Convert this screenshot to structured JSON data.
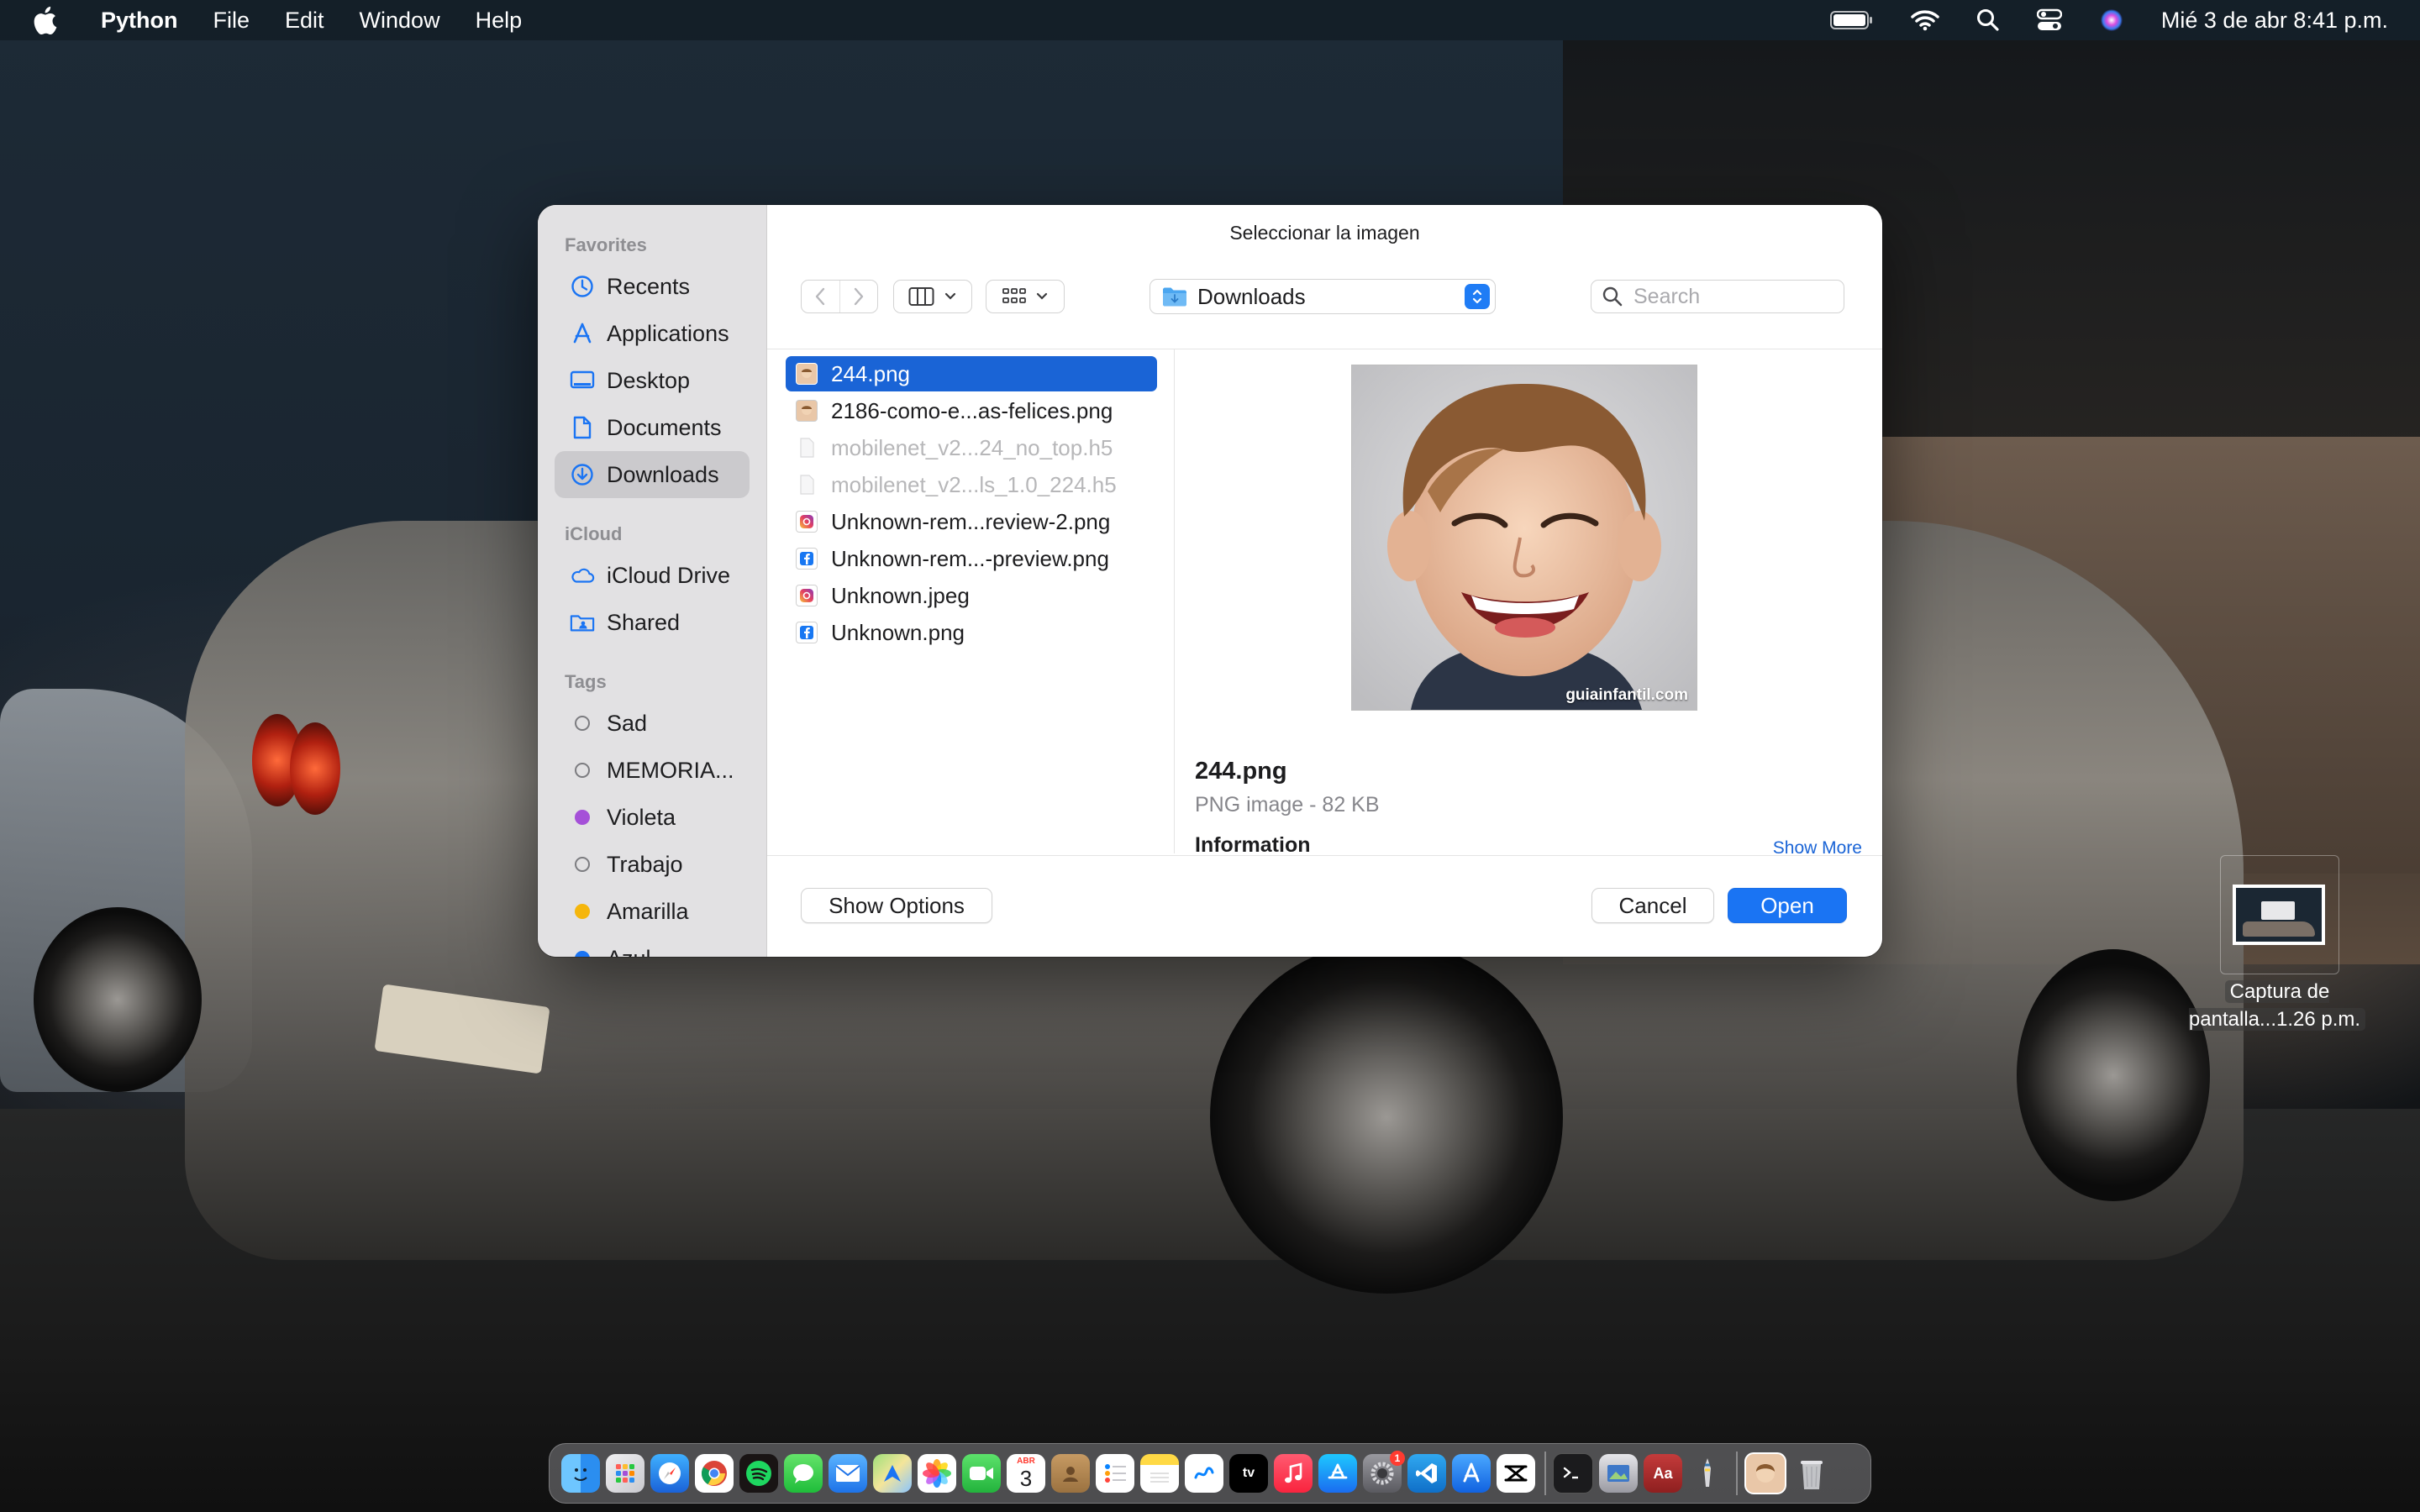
{
  "menubar": {
    "app_name": "Python",
    "menus": [
      "File",
      "Edit",
      "Window",
      "Help"
    ],
    "clock": "Mié 3 de abr  8:41 p.m."
  },
  "dialog": {
    "title": "Seleccionar la imagen",
    "location": "Downloads",
    "search_placeholder": "Search",
    "sidebar": {
      "favorites_header": "Favorites",
      "favorites": [
        "Recents",
        "Applications",
        "Desktop",
        "Documents",
        "Downloads"
      ],
      "icloud_header": "iCloud",
      "icloud": [
        "iCloud Drive",
        "Shared"
      ],
      "tags_header": "Tags",
      "tags": [
        {
          "label": "Sad",
          "color": "none"
        },
        {
          "label": "MEMORIA...",
          "color": "none"
        },
        {
          "label": "Violeta",
          "color": "#a550d8"
        },
        {
          "label": "Trabajo",
          "color": "none"
        },
        {
          "label": "Amarilla",
          "color": "#f5b60c"
        },
        {
          "label": "Azul",
          "color": "#1a74f3"
        }
      ]
    },
    "files": [
      {
        "name": "244.png",
        "icon": "photo-thumb-icon",
        "selected": true,
        "dimmed": false
      },
      {
        "name": "2186-como-e...as-felices.png",
        "icon": "photo-thumb-icon",
        "selected": false,
        "dimmed": false
      },
      {
        "name": "mobilenet_v2...24_no_top.h5",
        "icon": "document-icon",
        "selected": false,
        "dimmed": true
      },
      {
        "name": "mobilenet_v2...ls_1.0_224.h5",
        "icon": "document-icon",
        "selected": false,
        "dimmed": true
      },
      {
        "name": "Unknown-rem...review-2.png",
        "icon": "instagram-icon",
        "selected": false,
        "dimmed": false
      },
      {
        "name": "Unknown-rem...-preview.png",
        "icon": "facebook-icon",
        "selected": false,
        "dimmed": false
      },
      {
        "name": "Unknown.jpeg",
        "icon": "instagram-icon",
        "selected": false,
        "dimmed": false
      },
      {
        "name": "Unknown.png",
        "icon": "facebook-icon",
        "selected": false,
        "dimmed": false
      }
    ],
    "preview": {
      "watermark": "guiainfantil.com",
      "file_name": "244.png",
      "file_kind": "PNG image - 82 KB",
      "info_header": "Information",
      "show_more": "Show More"
    },
    "buttons": {
      "show_options": "Show Options",
      "cancel": "Cancel",
      "open": "Open"
    }
  },
  "desktop": {
    "screenshot_label": "Captura de pantalla...1.26 p.m."
  },
  "dock": {
    "calendar_month": "ABR",
    "calendar_day": "3",
    "settings_badge": "1",
    "dictionary_label": "Aa"
  },
  "colors": {
    "accent": "#1a74f3",
    "selection": "#1a64d6"
  }
}
